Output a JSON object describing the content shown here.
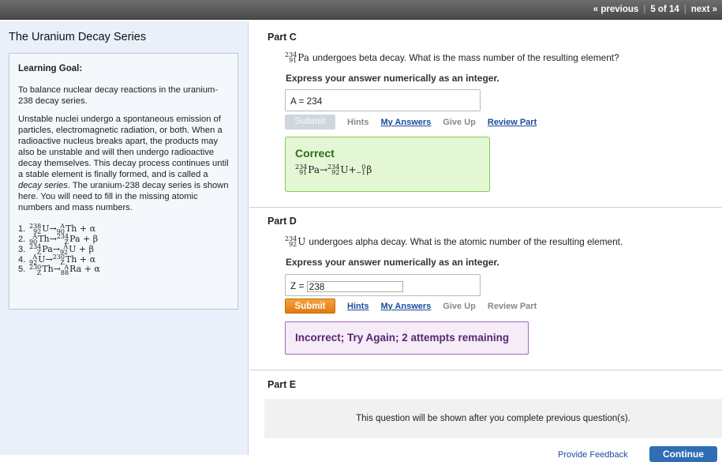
{
  "nav": {
    "previous": "« previous",
    "position": "5 of 14",
    "next": "next »"
  },
  "sidebar": {
    "title": "The Uranium Decay Series",
    "goal_heading": "Learning Goal:",
    "goal_text": "To balance nuclear decay reactions in the uranium-238 decay series.",
    "intro_parts": [
      "Unstable nuclei undergo a spontaneous emission of particles, electromagnetic radiation, or both. When a radioactive nucleus breaks apart, the products may also be unstable and will then undergo radioactive decay themselves. This decay process continues until a stable element is finally formed, and is called a ",
      "decay series",
      ". The uranium-238 decay series is shown here. You will need to fill in the missing atomic numbers and mass numbers."
    ],
    "equations": [
      {
        "num": "1.",
        "a": {
          "m": "238",
          "z": "92",
          "s": "U"
        },
        "b": {
          "m": "A",
          "z": "90",
          "s": "Th"
        },
        "tail": "+ α"
      },
      {
        "num": "2.",
        "a": {
          "m": "A",
          "z": "90",
          "s": "Th"
        },
        "b": {
          "m": "234",
          "z": "Z",
          "s": "Pa"
        },
        "tail": "+ β"
      },
      {
        "num": "3.",
        "a": {
          "m": "234",
          "z": "Z",
          "s": "Pa"
        },
        "b": {
          "m": "A",
          "z": "92",
          "s": "U"
        },
        "tail": "+ β"
      },
      {
        "num": "4.",
        "a": {
          "m": "A",
          "z": "92",
          "s": "U"
        },
        "b": {
          "m": "230",
          "z": "Z",
          "s": "Th"
        },
        "tail": "+ α"
      },
      {
        "num": "5.",
        "a": {
          "m": "230",
          "z": "Z",
          "s": "Th"
        },
        "b": {
          "m": "A",
          "z": "88",
          "s": "Ra"
        },
        "tail": "+ α"
      }
    ]
  },
  "partC": {
    "heading": "Part C",
    "iso": {
      "m": "234",
      "z": "91",
      "s": "Pa"
    },
    "question": "undergoes beta decay. What is the mass number of the resulting element?",
    "instruction": "Express your answer numerically as an integer.",
    "answer": "A = 234",
    "submit": "Submit",
    "hints": "Hints",
    "my_answers": "My Answers",
    "give_up": "Give Up",
    "review": "Review Part",
    "result_heading": "Correct",
    "result_eq": {
      "a": {
        "m": "234",
        "z": "91",
        "s": "Pa"
      },
      "b": {
        "m": "234",
        "z": "92",
        "s": "U"
      },
      "c": {
        "m": "0",
        "z": "−1",
        "s": "β"
      }
    }
  },
  "partD": {
    "heading": "Part D",
    "iso": {
      "m": "234",
      "z": "92",
      "s": "U"
    },
    "question": "undergoes alpha decay. What is the atomic number of the resulting element.",
    "instruction": "Express your answer numerically as an integer.",
    "label": "Z = ",
    "value": "238",
    "submit": "Submit",
    "hints": "Hints",
    "my_answers": "My Answers",
    "give_up": "Give Up",
    "review": "Review Part",
    "feedback": "Incorrect; Try Again; 2 attempts remaining"
  },
  "partE": {
    "heading": "Part E",
    "placeholder": "This question will be shown after you complete previous question(s)."
  },
  "footer": {
    "feedback": "Provide Feedback",
    "continue": "Continue"
  }
}
